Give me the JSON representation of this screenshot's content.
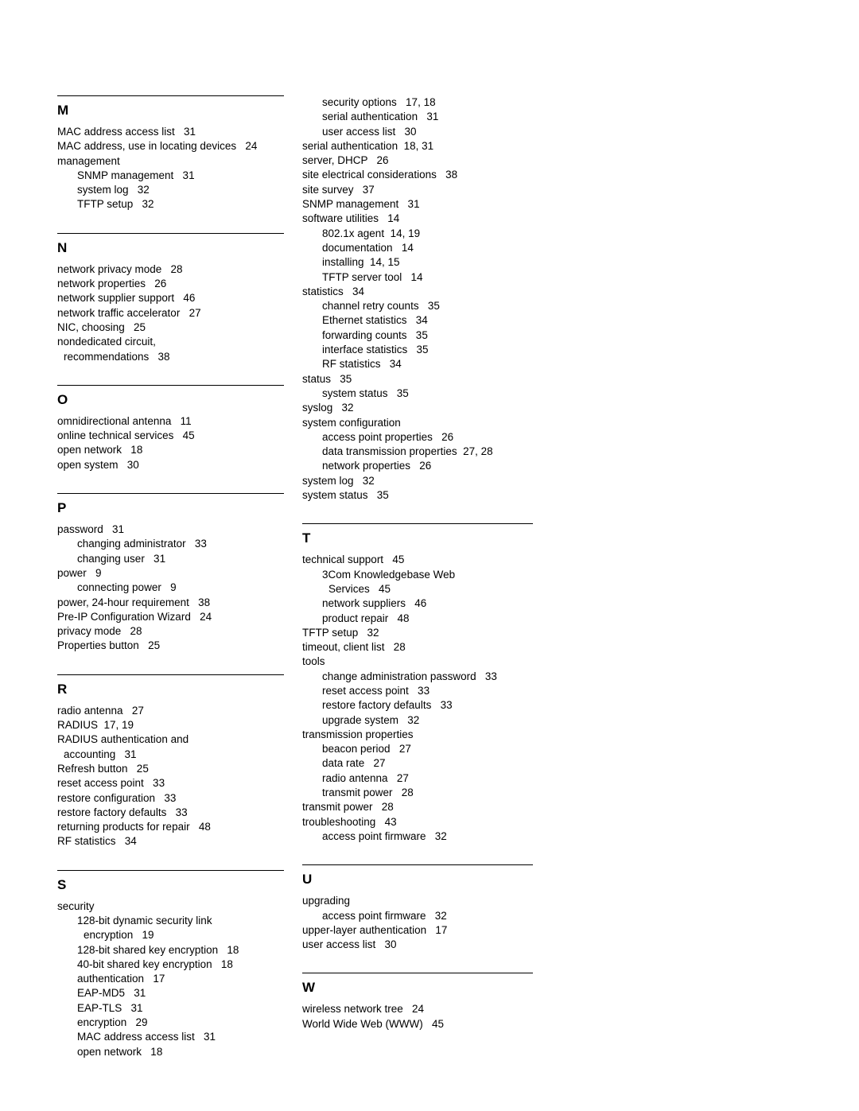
{
  "document": {
    "type": "index",
    "columns": [
      {
        "id": "left-column",
        "sections": [
          {
            "letter": "M",
            "entries": [
              {
                "text": "MAC address access list   31",
                "level": 0
              },
              {
                "text": "MAC address, use in locating devices   24",
                "level": 0
              },
              {
                "text": "management",
                "level": 0
              },
              {
                "text": "SNMP management   31",
                "level": 1
              },
              {
                "text": "system log   32",
                "level": 1
              },
              {
                "text": "TFTP setup   32",
                "level": 1
              }
            ]
          },
          {
            "letter": "N",
            "entries": [
              {
                "text": "network privacy mode   28",
                "level": 0
              },
              {
                "text": "network properties   26",
                "level": 0
              },
              {
                "text": "network supplier support   46",
                "level": 0
              },
              {
                "text": "network traffic accelerator   27",
                "level": 0
              },
              {
                "text": "NIC, choosing   25",
                "level": 0
              },
              {
                "text": "nondedicated circuit,",
                "level": 0
              },
              {
                "text": "recommendations   38",
                "level": 0,
                "continuation": true
              }
            ]
          },
          {
            "letter": "O",
            "entries": [
              {
                "text": "omnidirectional antenna   11",
                "level": 0
              },
              {
                "text": "online technical services   45",
                "level": 0
              },
              {
                "text": "open network   18",
                "level": 0
              },
              {
                "text": "open system   30",
                "level": 0
              }
            ]
          },
          {
            "letter": "P",
            "entries": [
              {
                "text": "password   31",
                "level": 0
              },
              {
                "text": "changing administrator   33",
                "level": 1
              },
              {
                "text": "changing user   31",
                "level": 1
              },
              {
                "text": "power   9",
                "level": 0
              },
              {
                "text": "connecting power   9",
                "level": 1
              },
              {
                "text": "power, 24-hour requirement   38",
                "level": 0
              },
              {
                "text": "Pre-IP Configuration Wizard   24",
                "level": 0
              },
              {
                "text": "privacy mode   28",
                "level": 0
              },
              {
                "text": "Properties button   25",
                "level": 0
              }
            ]
          },
          {
            "letter": "R",
            "entries": [
              {
                "text": "radio antenna   27",
                "level": 0
              },
              {
                "text": "RADIUS  17, 19",
                "level": 0
              },
              {
                "text": "RADIUS authentication and",
                "level": 0
              },
              {
                "text": "accounting   31",
                "level": 0,
                "continuation": true
              },
              {
                "text": "Refresh button   25",
                "level": 0
              },
              {
                "text": "reset access point   33",
                "level": 0
              },
              {
                "text": "restore configuration   33",
                "level": 0
              },
              {
                "text": "restore factory defaults   33",
                "level": 0
              },
              {
                "text": "returning products for repair   48",
                "level": 0
              },
              {
                "text": "RF statistics   34",
                "level": 0
              }
            ]
          },
          {
            "letter": "S",
            "entries": [
              {
                "text": "security",
                "level": 0
              },
              {
                "text": "128-bit dynamic security link",
                "level": 1
              },
              {
                "text": "encryption   19",
                "level": 1,
                "continuation": true
              },
              {
                "text": "128-bit shared key encryption   18",
                "level": 1
              },
              {
                "text": "40-bit shared key encryption   18",
                "level": 1
              },
              {
                "text": "authentication   17",
                "level": 1
              },
              {
                "text": "EAP-MD5   31",
                "level": 1
              },
              {
                "text": "EAP-TLS   31",
                "level": 1
              },
              {
                "text": "encryption   29",
                "level": 1
              },
              {
                "text": "MAC address access list   31",
                "level": 1
              },
              {
                "text": "open network   18",
                "level": 1
              }
            ]
          }
        ]
      },
      {
        "id": "right-column",
        "sections": [
          {
            "letter": "",
            "entries": [
              {
                "text": "security options   17, 18",
                "level": 1
              },
              {
                "text": "serial authentication   31",
                "level": 1
              },
              {
                "text": "user access list   30",
                "level": 1
              },
              {
                "text": "serial authentication  18, 31",
                "level": 0
              },
              {
                "text": "server, DHCP   26",
                "level": 0
              },
              {
                "text": "site electrical considerations   38",
                "level": 0
              },
              {
                "text": "site survey   37",
                "level": 0
              },
              {
                "text": "SNMP management   31",
                "level": 0
              },
              {
                "text": "software utilities   14",
                "level": 0
              },
              {
                "text": "802.1x agent  14, 19",
                "level": 1
              },
              {
                "text": "documentation   14",
                "level": 1
              },
              {
                "text": "installing  14, 15",
                "level": 1
              },
              {
                "text": "TFTP server tool   14",
                "level": 1
              },
              {
                "text": "statistics   34",
                "level": 0
              },
              {
                "text": "channel retry counts   35",
                "level": 1
              },
              {
                "text": "Ethernet statistics   34",
                "level": 1
              },
              {
                "text": "forwarding counts   35",
                "level": 1
              },
              {
                "text": "interface statistics   35",
                "level": 1
              },
              {
                "text": "RF statistics   34",
                "level": 1
              },
              {
                "text": "status   35",
                "level": 0
              },
              {
                "text": "system status   35",
                "level": 1
              },
              {
                "text": "syslog   32",
                "level": 0
              },
              {
                "text": "system configuration",
                "level": 0
              },
              {
                "text": "access point properties   26",
                "level": 1
              },
              {
                "text": "data transmission properties  27, 28",
                "level": 1
              },
              {
                "text": "network properties   26",
                "level": 1
              },
              {
                "text": "system log   32",
                "level": 0
              },
              {
                "text": "system status   35",
                "level": 0
              }
            ]
          },
          {
            "letter": "T",
            "entries": [
              {
                "text": "technical support   45",
                "level": 0
              },
              {
                "text": "3Com Knowledgebase Web",
                "level": 1
              },
              {
                "text": "Services   45",
                "level": 1,
                "continuation": true
              },
              {
                "text": "network suppliers   46",
                "level": 1
              },
              {
                "text": "product repair   48",
                "level": 1
              },
              {
                "text": "TFTP setup   32",
                "level": 0
              },
              {
                "text": "timeout, client list   28",
                "level": 0
              },
              {
                "text": "tools",
                "level": 0
              },
              {
                "text": "change administration password   33",
                "level": 1
              },
              {
                "text": "reset access point   33",
                "level": 1
              },
              {
                "text": "restore factory defaults   33",
                "level": 1
              },
              {
                "text": "upgrade system   32",
                "level": 1
              },
              {
                "text": "transmission properties",
                "level": 0
              },
              {
                "text": "beacon period   27",
                "level": 1
              },
              {
                "text": "data rate   27",
                "level": 1
              },
              {
                "text": "radio antenna   27",
                "level": 1
              },
              {
                "text": "transmit power   28",
                "level": 1
              },
              {
                "text": "transmit power   28",
                "level": 0
              },
              {
                "text": "troubleshooting   43",
                "level": 0
              },
              {
                "text": "access point firmware   32",
                "level": 1
              }
            ]
          },
          {
            "letter": "U",
            "entries": [
              {
                "text": "upgrading",
                "level": 0
              },
              {
                "text": "access point firmware   32",
                "level": 1
              },
              {
                "text": "upper-layer authentication   17",
                "level": 0
              },
              {
                "text": "user access list   30",
                "level": 0
              }
            ]
          },
          {
            "letter": "W",
            "entries": [
              {
                "text": "wireless network tree   24",
                "level": 0
              },
              {
                "text": "World Wide Web (WWW)   45",
                "level": 0
              }
            ]
          }
        ]
      }
    ]
  }
}
